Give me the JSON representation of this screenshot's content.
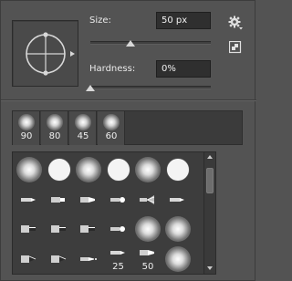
{
  "brush_panel": {
    "preview_icon": "brush-tip-crosshair-icon",
    "size": {
      "label": "Size:",
      "value": "50 px",
      "slider_fraction": 0.33
    },
    "hardness": {
      "label": "Hardness:",
      "value": "0%",
      "slider_fraction": 0.0
    },
    "settings_icon": "gear-icon",
    "new_preset_icon": "new-preset-icon"
  },
  "recent_brushes": [
    {
      "size_label": "90",
      "icon": "soft-round-brush-icon"
    },
    {
      "size_label": "80",
      "icon": "soft-round-brush-icon"
    },
    {
      "size_label": "45",
      "icon": "soft-round-brush-icon"
    },
    {
      "size_label": "60",
      "icon": "soft-round-brush-icon"
    }
  ],
  "brush_grid": {
    "rows": [
      [
        {
          "icon": "soft-round-brush-icon",
          "label": ""
        },
        {
          "icon": "hard-round-brush-icon",
          "label": ""
        },
        {
          "icon": "soft-round-brush-icon",
          "label": ""
        },
        {
          "icon": "hard-round-brush-icon",
          "label": ""
        },
        {
          "icon": "soft-round-brush-icon",
          "label": ""
        },
        {
          "icon": "hard-round-brush-icon",
          "label": ""
        }
      ],
      [
        {
          "icon": "pencil-tip-brush-icon",
          "label": ""
        },
        {
          "icon": "marker-tip-brush-icon",
          "label": ""
        },
        {
          "icon": "chisel-tip-brush-icon",
          "label": ""
        },
        {
          "icon": "round-tip-brush-icon",
          "label": ""
        },
        {
          "icon": "fan-brush-icon",
          "label": ""
        },
        {
          "icon": "pencil-tip-brush-icon",
          "label": ""
        }
      ],
      [
        {
          "icon": "flat-tip-brush-icon",
          "label": ""
        },
        {
          "icon": "flat-tip-brush-icon",
          "label": ""
        },
        {
          "icon": "flat-tip-brush-icon",
          "label": ""
        },
        {
          "icon": "round-tip-brush-icon",
          "label": ""
        },
        {
          "icon": "soft-round-brush-icon",
          "label": ""
        },
        {
          "icon": "soft-round-brush-icon",
          "label": ""
        }
      ],
      [
        {
          "icon": "angled-tip-brush-icon",
          "label": ""
        },
        {
          "icon": "angled-tip-brush-icon",
          "label": ""
        },
        {
          "icon": "airbrush-tip-brush-icon",
          "label": ""
        },
        {
          "icon": "pencil-tip-brush-icon",
          "label": "25"
        },
        {
          "icon": "chisel-tip-brush-icon",
          "label": "50"
        },
        {
          "icon": "soft-round-brush-icon",
          "label": ""
        }
      ]
    ]
  },
  "colors": {
    "panel_bg": "#535353",
    "field_bg": "#2f2f2f",
    "grid_bg": "#3d3d3d",
    "text": "#eaeaea"
  }
}
